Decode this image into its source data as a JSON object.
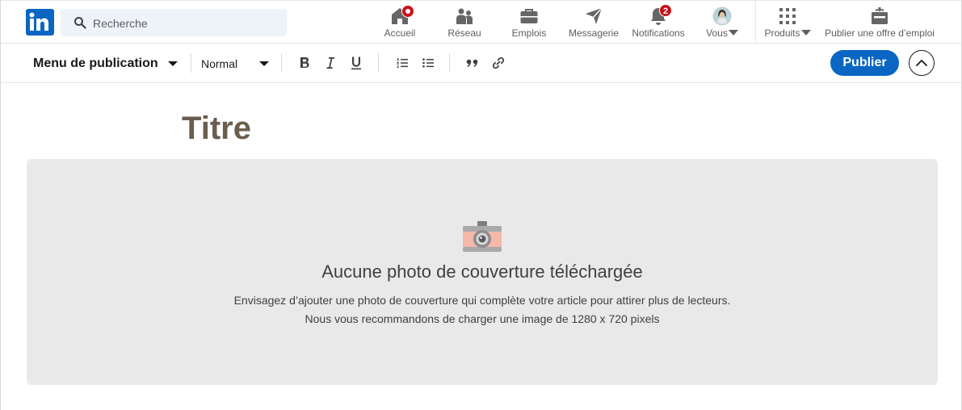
{
  "nav": {
    "search_placeholder": "Recherche",
    "items": [
      {
        "label": "Accueil",
        "icon": "home-icon"
      },
      {
        "label": "Réseau",
        "icon": "network-icon"
      },
      {
        "label": "Emplois",
        "icon": "briefcase-icon"
      },
      {
        "label": "Messagerie",
        "icon": "send-icon"
      },
      {
        "label": "Notifications",
        "icon": "bell-icon",
        "badge": "2"
      },
      {
        "label": "Vous",
        "icon": "avatar"
      },
      {
        "label": "Produits",
        "icon": "grid-icon"
      },
      {
        "label": "Publier une offre d’emploi",
        "icon": "job-post-icon"
      }
    ]
  },
  "toolbar": {
    "menu_label": "Menu de publication",
    "style_value": "Normal",
    "publish_label": "Publier"
  },
  "editor": {
    "title_placeholder": "Titre",
    "cover": {
      "heading": "Aucune photo de couverture téléchargée",
      "line1": "Envisagez d’ajouter une photo de couverture qui complète votre article pour attirer plus de lecteurs.",
      "line2": "Nous vous recommandons de charger une image de 1280 x 720 pixels"
    }
  },
  "colors": {
    "brand": "#0a66c2",
    "badge": "#cc1016",
    "cover_bg": "#e9e9e9",
    "title": "#6b5e50"
  }
}
